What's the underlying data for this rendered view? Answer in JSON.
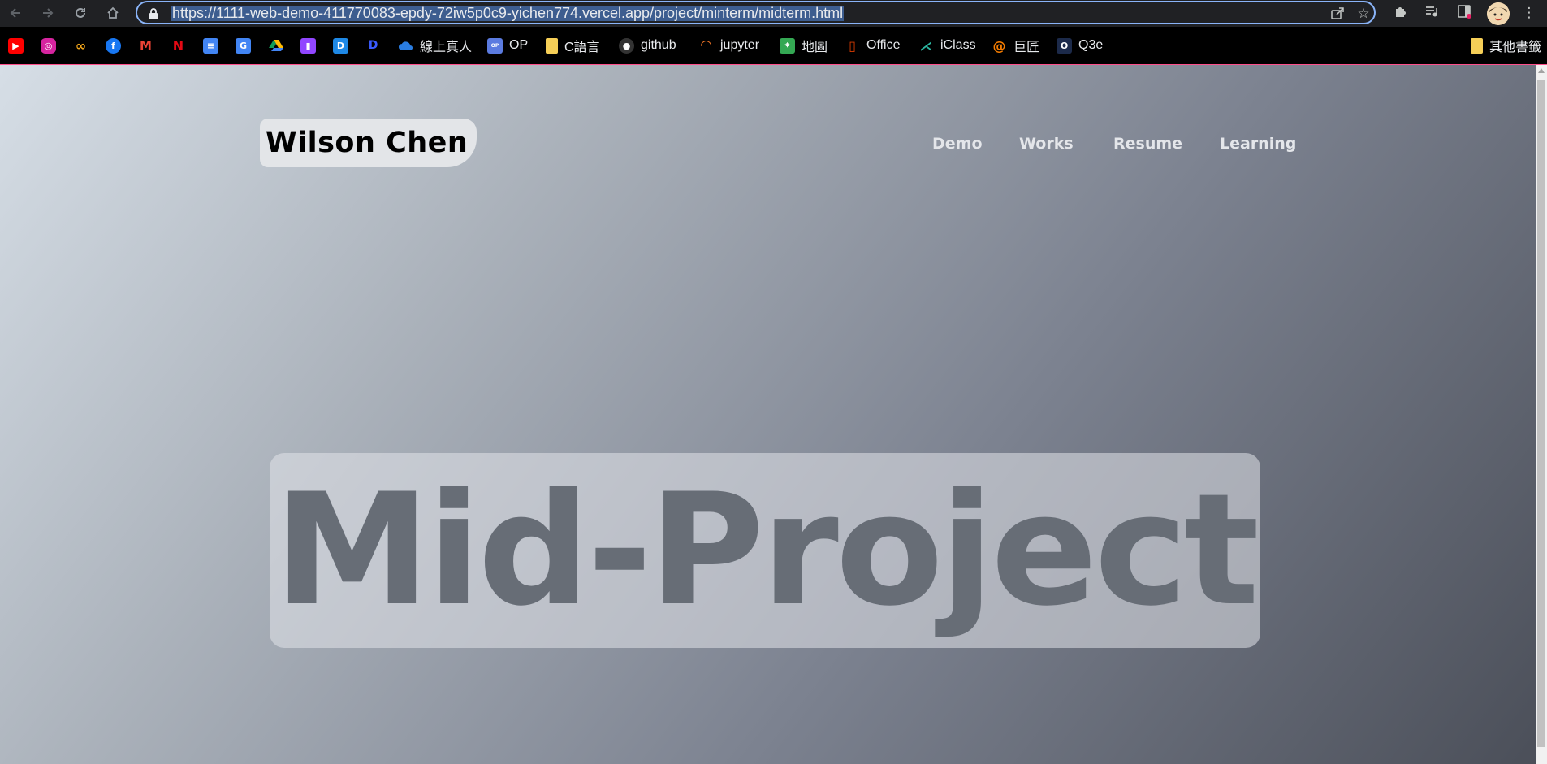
{
  "browser": {
    "url": "https://1111-web-demo-411770083-epdy-72iw5p0c9-yichen774.vercel.app/project/minterm/midterm.html",
    "nav": [
      "back-icon",
      "forward-icon",
      "reload-icon",
      "home-icon"
    ],
    "omnibox_icons": [
      "share-icon",
      "star-icon"
    ],
    "extension_icons": [
      "puzzle-icon",
      "media-icon",
      "sidepanel-icon",
      "avatar",
      "menu-icon"
    ]
  },
  "bookmarks": {
    "items": [
      {
        "label": "",
        "icon": "youtube-icon",
        "color": "#ff0000"
      },
      {
        "label": "",
        "icon": "instagram-icon",
        "color": "#d6249f"
      },
      {
        "label": "",
        "icon": "loop-icon",
        "color": "#f2a51a"
      },
      {
        "label": "",
        "icon": "facebook-icon",
        "color": "#1877f2"
      },
      {
        "label": "",
        "icon": "gmail-icon",
        "color": "#ea4335"
      },
      {
        "label": "",
        "icon": "netflix-icon",
        "color": "#e50914"
      },
      {
        "label": "",
        "icon": "docs-icon",
        "color": "#4285f4"
      },
      {
        "label": "",
        "icon": "translate-icon",
        "color": "#4285f4"
      },
      {
        "label": "",
        "icon": "drive-icon",
        "color": "#0f9d58"
      },
      {
        "label": "",
        "icon": "twitch-icon",
        "color": "#9146ff"
      },
      {
        "label": "",
        "icon": "app-icon",
        "color": "#1e88e5"
      },
      {
        "label": "",
        "icon": "disney-icon",
        "color": "#1a3db3"
      },
      {
        "label": "線上真人",
        "icon": "cloud-icon",
        "color": "#2a7de1"
      },
      {
        "label": "OP",
        "icon": "op-icon",
        "color": "#5b7be0"
      },
      {
        "label": "C語言",
        "icon": "folder-icon",
        "color": "#f6cf57"
      },
      {
        "label": "github",
        "icon": "github-icon",
        "color": "#333333"
      },
      {
        "label": "jupyter",
        "icon": "jupyter-icon",
        "color": "#f37626"
      },
      {
        "label": "地圖",
        "icon": "maps-icon",
        "color": "#34a853"
      },
      {
        "label": "Office",
        "icon": "office-icon",
        "color": "#d83b01"
      },
      {
        "label": "iClass",
        "icon": "iclass-icon",
        "color": "#2bb5a0"
      },
      {
        "label": "巨匠",
        "icon": "spiral-icon",
        "color": "#f57c00"
      },
      {
        "label": "Q3e",
        "icon": "q3e-icon",
        "color": "#1c2a4a"
      }
    ],
    "other": {
      "label": "其他書籤",
      "icon": "folder-icon",
      "color": "#f6cf57"
    }
  },
  "site": {
    "brand": "Wilson Chen",
    "nav": [
      {
        "label": "Demo"
      },
      {
        "label": "Works"
      },
      {
        "label": "Resume"
      },
      {
        "label": "Learning"
      }
    ],
    "hero_title": "Mid-Project"
  }
}
